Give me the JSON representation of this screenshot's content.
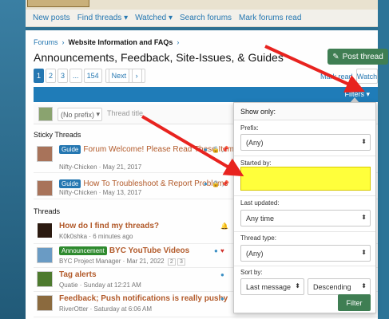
{
  "nav": {
    "items": [
      "New posts",
      "Find threads",
      "Watched",
      "Search forums",
      "Mark forums read"
    ]
  },
  "breadcrumb": {
    "root": "Forums",
    "current": "Website Information and FAQs"
  },
  "page_title": "Announcements, Feedback, Site-Issues, & Guides",
  "post_thread_label": "Post thread",
  "pagination": {
    "pages": [
      "1",
      "2",
      "3",
      "...",
      "154"
    ],
    "next_label": "Next"
  },
  "mark_read_label": "Mark read",
  "watch_label": "Watch",
  "filters_label": "Filters",
  "composer": {
    "prefix_label": "(No prefix)",
    "title_placeholder": "Thread title"
  },
  "sections": {
    "sticky": "Sticky Threads",
    "threads": "Threads"
  },
  "threads": [
    {
      "badge": "Guide",
      "title": "Forum Welcome! Please Read These Items",
      "meta": "Nifty-Chicken · May 21, 2017"
    },
    {
      "badge": "Guide",
      "title": "How To Troubleshoot & Report Problems",
      "meta": "Nifty-Chicken · May 13, 2017"
    },
    {
      "badge": "",
      "title": "How do I find my threads?",
      "meta": "K0k0shka · 6 minutes ago"
    },
    {
      "badge": "Announcement",
      "title": "BYC YouTube Videos",
      "meta": "BYC Project Manager · Mar 21, 2022",
      "pages": [
        "2",
        "3"
      ]
    },
    {
      "badge": "",
      "title": "Tag alerts",
      "meta": "Quatie · Sunday at 12:21 AM"
    },
    {
      "badge": "",
      "title": "Feedback; Push notifications is really pushy",
      "meta": "RiverOtter · Saturday at 6:06 AM"
    }
  ],
  "filter_menu": {
    "header": "Show only:",
    "prefix_label": "Prefix:",
    "prefix_value": "(Any)",
    "started_by_label": "Started by:",
    "last_updated_label": "Last updated:",
    "last_updated_value": "Any time",
    "thread_type_label": "Thread type:",
    "thread_type_value": "(Any)",
    "sort_label": "Sort by:",
    "sort_field": "Last message",
    "sort_order": "Descending",
    "filter_button": "Filter"
  },
  "colors": {
    "accent": "#1f7cb8",
    "post_button": "#3f7e53",
    "highlight": "#ffff3b",
    "arrow": "#e8231f"
  }
}
